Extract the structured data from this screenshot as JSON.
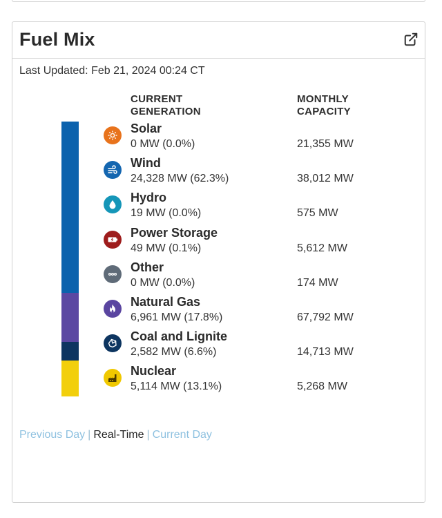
{
  "card": {
    "title": "Fuel Mix",
    "last_updated": "Last Updated: Feb 21, 2024 00:24 CT"
  },
  "columns": {
    "generation_line1": "CURRENT",
    "generation_line2": "GENERATION",
    "capacity_line1": "MONTHLY",
    "capacity_line2": "CAPACITY"
  },
  "fuels": [
    {
      "name": "Solar",
      "generation": "0 MW (0.0%)",
      "capacity": "21,355 MW",
      "icon": "sun-icon",
      "color": "#e8731c"
    },
    {
      "name": "Wind",
      "generation": "24,328 MW (62.3%)",
      "capacity": "38,012 MW",
      "icon": "wind-icon",
      "color": "#1466b0"
    },
    {
      "name": "Hydro",
      "generation": "19 MW (0.0%)",
      "capacity": "575 MW",
      "icon": "water-drop-icon",
      "color": "#1596b8"
    },
    {
      "name": "Power Storage",
      "generation": "49 MW (0.1%)",
      "capacity": "5,612 MW",
      "icon": "battery-icon",
      "color": "#9e1c1c"
    },
    {
      "name": "Other",
      "generation": "0 MW (0.0%)",
      "capacity": "174 MW",
      "icon": "ellipsis-icon",
      "color": "#5f6b78"
    },
    {
      "name": "Natural Gas",
      "generation": "6,961 MW (17.8%)",
      "capacity": "67,792 MW",
      "icon": "flame-icon",
      "color": "#5a45a0"
    },
    {
      "name": "Coal and Lignite",
      "generation": "2,582 MW (6.6%)",
      "capacity": "14,713 MW",
      "icon": "coal-icon",
      "color": "#0d3560"
    },
    {
      "name": "Nuclear",
      "generation": "5,114 MW (13.1%)",
      "capacity": "5,268 MW",
      "icon": "nuclear-plant-icon",
      "color": "#f0c800"
    }
  ],
  "mix_bar": [
    {
      "fuel": "Wind",
      "share": 62.3,
      "color": "#0b62ad"
    },
    {
      "fuel": "Natural Gas",
      "share": 17.8,
      "color": "#5b48a2"
    },
    {
      "fuel": "Coal and Lignite",
      "share": 6.6,
      "color": "#0d3560"
    },
    {
      "fuel": "Nuclear",
      "share": 13.1,
      "color": "#f2cf0c"
    }
  ],
  "day_nav": {
    "previous": "Previous Day",
    "realtime": "Real-Time",
    "current": "Current Day",
    "separator": "|"
  }
}
